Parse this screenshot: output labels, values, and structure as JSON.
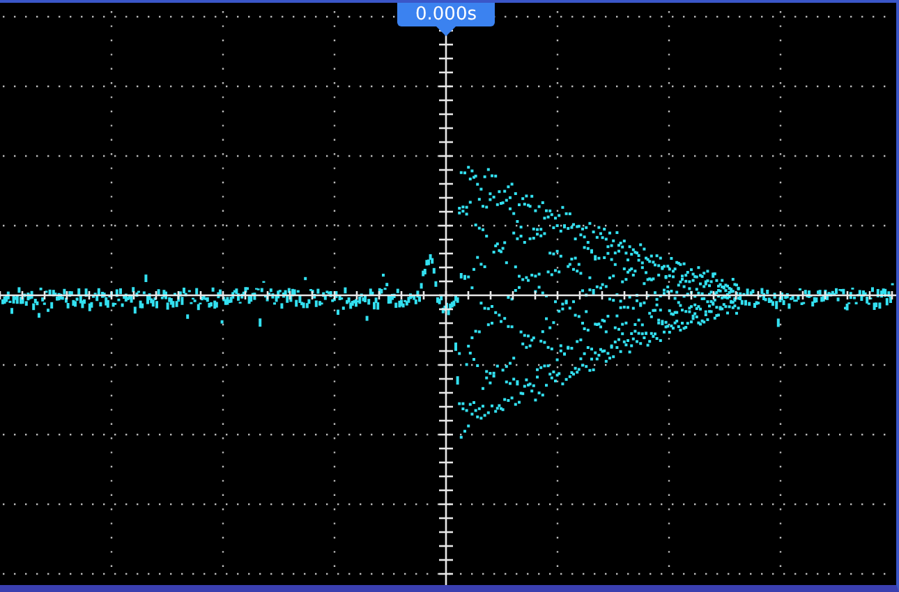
{
  "trigger_marker": {
    "label": "0.000s"
  }
}
